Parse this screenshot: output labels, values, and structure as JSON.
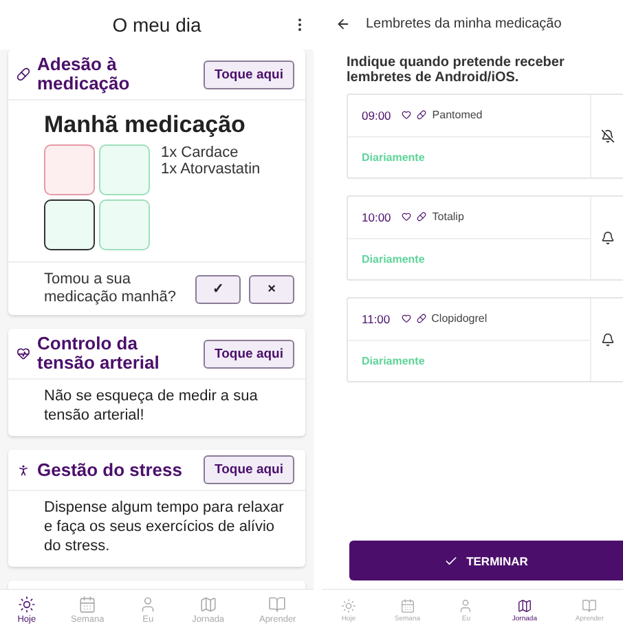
{
  "left": {
    "title": "O meu dia",
    "cards": [
      {
        "kind": "medication",
        "title": "Adesão à medicação",
        "button": "Toque aqui",
        "subtitle": "Manhã medicação",
        "slots": [
          {
            "kind": "missed"
          },
          {
            "kind": "taken"
          },
          {
            "kind": "current"
          },
          {
            "kind": "taken"
          }
        ],
        "medicines": [
          "1x Cardace",
          "1x Atorvastatin"
        ],
        "question": "Tomou a sua medicação manhã?",
        "confirm": "✓",
        "reject": "×"
      },
      {
        "kind": "pressure",
        "title": "Controlo da tensão arterial",
        "button": "Toque aqui",
        "text": "Não se esqueça de medir a sua tensão arterial!"
      },
      {
        "kind": "stress",
        "title": "Gestão do stress",
        "button": "Toque aqui",
        "text": "Dispense algum tempo para relaxar e faça os seus exercícios de alívio do stress."
      },
      {
        "kind": "stub"
      }
    ],
    "nav": [
      {
        "label": "Hoje",
        "selected": true
      },
      {
        "label": "Semana",
        "selected": false
      },
      {
        "label": "Eu",
        "selected": false
      },
      {
        "label": "Jornada",
        "selected": false
      },
      {
        "label": "Aprender",
        "selected": false
      }
    ]
  },
  "right": {
    "title": "Lembretes da minha medicação",
    "instruction": "Indique quando pretende receber lembretes de Android/iOS.",
    "reminders": [
      {
        "time": "09:00",
        "name": "Pantomed",
        "repeat": "Diariamente",
        "enabled": false
      },
      {
        "time": "10:00",
        "name": "Totalip",
        "repeat": "Diariamente",
        "enabled": true
      },
      {
        "time": "11:00",
        "name": "Clopidogrel",
        "repeat": "Diariamente",
        "enabled": true
      }
    ],
    "button": "TERMINAR",
    "nav": [
      {
        "label": "Hoje",
        "selected": false
      },
      {
        "label": "Semana",
        "selected": false
      },
      {
        "label": "Eu",
        "selected": false
      },
      {
        "label": "Jornada",
        "selected": true
      },
      {
        "label": "Aprender",
        "selected": false
      }
    ]
  }
}
